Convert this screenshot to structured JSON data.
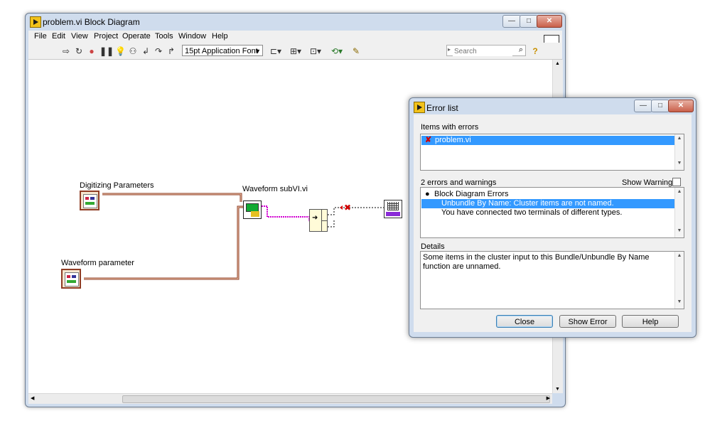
{
  "main_window": {
    "title": "problem.vi Block Diagram",
    "menu": [
      "File",
      "Edit",
      "View",
      "Project",
      "Operate",
      "Tools",
      "Window",
      "Help"
    ],
    "font_select": "15pt Application Font",
    "search_placeholder": "Search",
    "connector_pane_number": "2"
  },
  "diagram": {
    "digitizing_label": "Digitizing Parameters",
    "waveform_param_label": "Waveform parameter",
    "subvi_label": "Waveform subVI.vi"
  },
  "error_list": {
    "title": "Error list",
    "items_label": "Items with errors",
    "items": [
      "problem.vi"
    ],
    "count_label": "2 errors and warnings",
    "show_warnings_label": "Show Warnings",
    "errors_group": "Block Diagram Errors",
    "errors": [
      "Unbundle By Name: Cluster items are not named.",
      "You have connected two terminals of different types."
    ],
    "details_label": "Details",
    "details_text": "Some items in the cluster input to this Bundle/Unbundle By Name function are unnamed.",
    "buttons": {
      "close": "Close",
      "show_error": "Show Error",
      "help": "Help"
    }
  },
  "colors": {
    "wire_cluster": "#8f3c24",
    "wire_waveform": "#d000d0",
    "selection": "#3399ff"
  }
}
